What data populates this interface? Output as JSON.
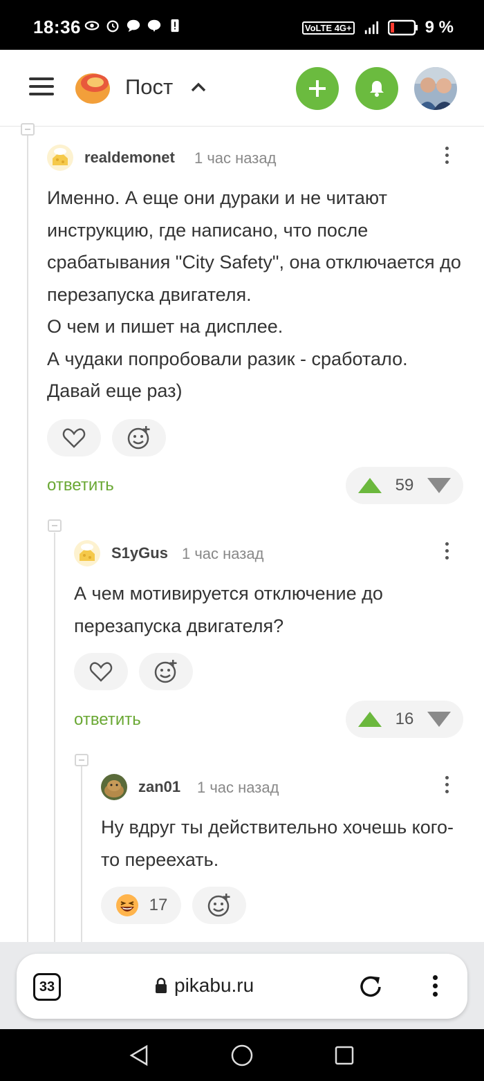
{
  "status_bar": {
    "time": "18:36",
    "network": "VoLTE 4G+",
    "battery": "9 %"
  },
  "header": {
    "title": "Пост",
    "icons": [
      "menu-icon",
      "pikabu-logo",
      "chevron-up-icon",
      "plus-icon",
      "bell-icon",
      "user-avatar"
    ],
    "accent_color": "#6bbb3f"
  },
  "comments": [
    {
      "author": "realdemonet",
      "time": "1 час назад",
      "text": "Именно. А еще они дураки и не читают инструкцию, где написано, что после срабатывания \"City Safety\", она отключается до перезапуска двигателя.\nО чем и пишет на дисплее.\nА чудаки попробовали разик - сработало. Давай еще раз)",
      "reply_label": "ответить",
      "rating": "59"
    },
    {
      "author": "S1yGus",
      "time": "1 час назад",
      "text": "А чем мотивируется отключение до перезапуска двигателя?",
      "reply_label": "ответить",
      "rating": "16"
    },
    {
      "author": "zan01",
      "time": "1 час назад",
      "text": "Ну вдруг ты действительно хочешь кого-то переехать.",
      "reaction_count": "17"
    }
  ],
  "browser": {
    "tab_count": "33",
    "url": "pikabu.ru"
  }
}
